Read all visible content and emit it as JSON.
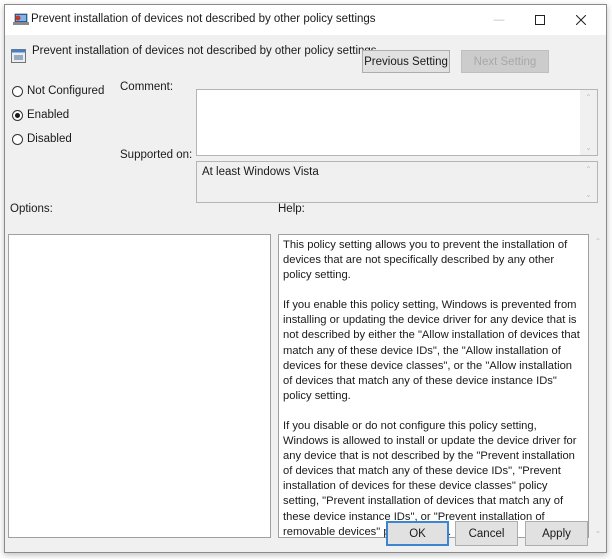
{
  "window": {
    "title": "Prevent installation of devices not described by other policy settings",
    "controls": {
      "minimize": "—",
      "maximize": "☐",
      "close": "✕"
    }
  },
  "header": {
    "setting_title": "Prevent installation of devices not described by other policy settings",
    "previous_label": "Previous Setting",
    "next_label": "Next Setting",
    "next_disabled": true
  },
  "state": {
    "options": [
      {
        "label": "Not Configured",
        "checked": false
      },
      {
        "label": "Enabled",
        "checked": true
      },
      {
        "label": "Disabled",
        "checked": false
      }
    ]
  },
  "comment": {
    "label": "Comment:",
    "value": ""
  },
  "supported": {
    "label": "Supported on:",
    "value": "At least Windows Vista"
  },
  "options_panel": {
    "label": "Options:"
  },
  "help_panel": {
    "label": "Help:",
    "paragraphs": [
      "This policy setting allows you to prevent the installation of devices that are not specifically described by any other policy setting.",
      "If you enable this policy setting, Windows is prevented from installing or updating the device driver for any device that is not described by either the \"Allow installation of devices that match any of these device IDs\", the \"Allow installation of devices for these device classes\", or the \"Allow installation of devices that match any of these device instance IDs\" policy setting.",
      "If you disable or do not configure this policy setting, Windows is allowed to install or update the device driver for any device that is not described by the \"Prevent installation of devices that match any of these device IDs\", \"Prevent installation of devices for these device classes\" policy setting, \"Prevent installation of devices that match any of these device instance IDs\", or \"Prevent installation of removable devices\" policy setting."
    ]
  },
  "footer": {
    "ok_label": "OK",
    "cancel_label": "Cancel",
    "apply_label": "Apply"
  },
  "icons": {
    "scroll_up": "⌃",
    "scroll_down": "⌄"
  },
  "colors": {
    "default_button_border": "#3c85d0",
    "window_bg": "#f0f0f0"
  }
}
